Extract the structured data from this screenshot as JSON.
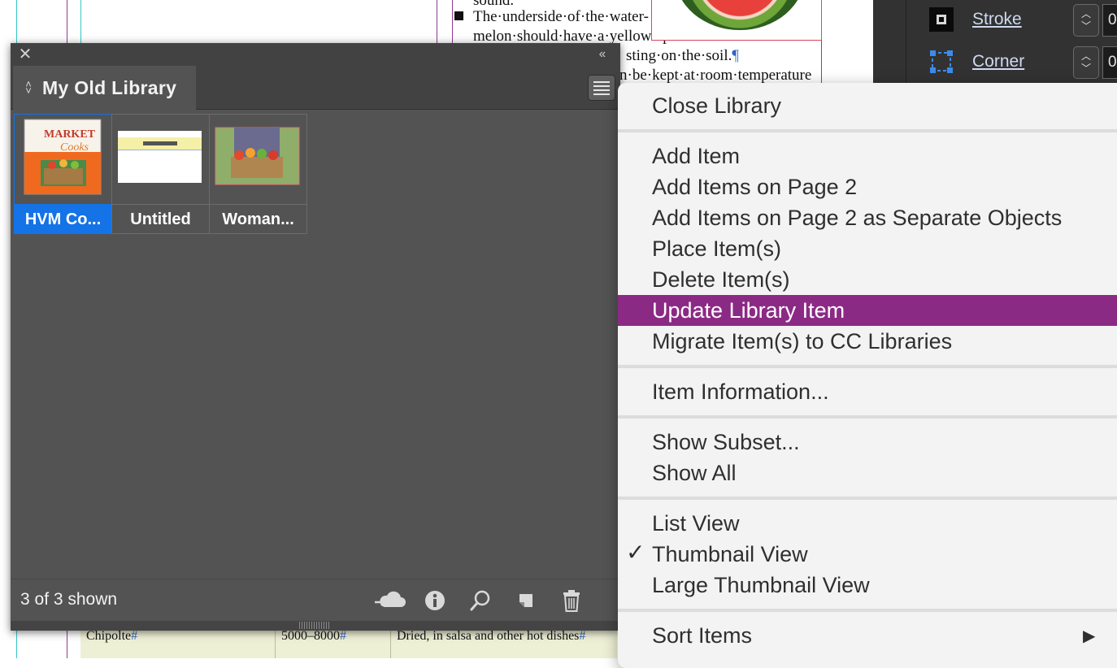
{
  "document": {
    "text_lines": [
      "sound.",
      "The·underside·of·the·water-",
      "melon·should·have·a·yellow·spot",
      "sting·on·the·soil.",
      "n·be·kept·at·room·temperature"
    ],
    "pilcrow": "¶",
    "table_row": {
      "name": "Chipolte",
      "range": "5000–8000",
      "use": "Dried, in salsa and other hot dishes"
    }
  },
  "properties_panel": {
    "stroke_label": "Stroke",
    "stroke_value": "0",
    "corner_label": "Corner",
    "corner_value": "0"
  },
  "library": {
    "tab_title": "My Old Library",
    "items": [
      {
        "label": "HVM Co...",
        "selected": true,
        "thumb": "market-cooks-cover"
      },
      {
        "label": "Untitled",
        "selected": false,
        "thumb": "yellow-band"
      },
      {
        "label": "Woman...",
        "selected": false,
        "thumb": "vegetable-crate"
      }
    ],
    "status": "3 of 3 shown",
    "tools": [
      "cloud-migrate-icon",
      "info-icon",
      "search-icon",
      "new-item-icon",
      "trash-icon"
    ],
    "thumb_text": {
      "title1": "MARKET",
      "title2": "Cooks"
    }
  },
  "context_menu": {
    "items": [
      {
        "label": "Close Library"
      },
      {
        "label": "Add Item"
      },
      {
        "label": "Add Items on Page 2"
      },
      {
        "label": "Add Items on Page 2 as Separate Objects"
      },
      {
        "label": "Place Item(s)"
      },
      {
        "label": "Delete Item(s)"
      },
      {
        "label": "Update Library Item",
        "highlighted": true
      },
      {
        "label": "Migrate Item(s) to CC Libraries"
      },
      {
        "label": "Item Information..."
      },
      {
        "label": "Show Subset..."
      },
      {
        "label": "Show All"
      },
      {
        "label": "List View"
      },
      {
        "label": "Thumbnail View",
        "checked": true
      },
      {
        "label": "Large Thumbnail View"
      },
      {
        "label": "Sort Items",
        "submenu": true
      }
    ],
    "check_glyph": "✓",
    "submenu_glyph": "▶"
  },
  "colors": {
    "selection_blue": "#1473e6",
    "menu_highlight": "#8b2a85",
    "panel_bg": "#535353"
  }
}
